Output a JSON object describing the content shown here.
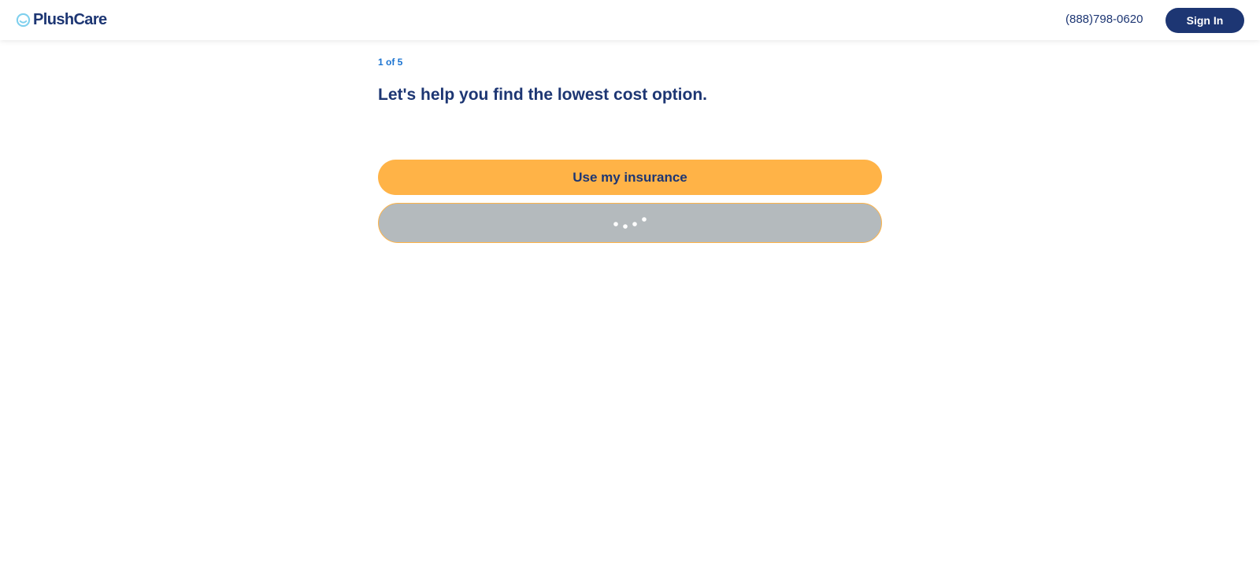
{
  "header": {
    "logo_text": "PlushCare",
    "phone": "(888)798-0620",
    "sign_in_label": "Sign In"
  },
  "main": {
    "step_indicator": "1 of 5",
    "title": "Let's help you find the lowest cost option.",
    "options": [
      {
        "label": "Use my insurance",
        "state": "default"
      },
      {
        "label": "",
        "state": "loading"
      }
    ]
  },
  "colors": {
    "brand_navy": "#1d3673",
    "accent_orange": "#ffb347",
    "step_blue": "#1a73d1",
    "loading_gray": "#b4babd",
    "logo_icon_blue": "#7fd0ee"
  },
  "icons": {
    "logo": "plushcare-smile-icon",
    "loading": "loading-spinner-icon"
  }
}
